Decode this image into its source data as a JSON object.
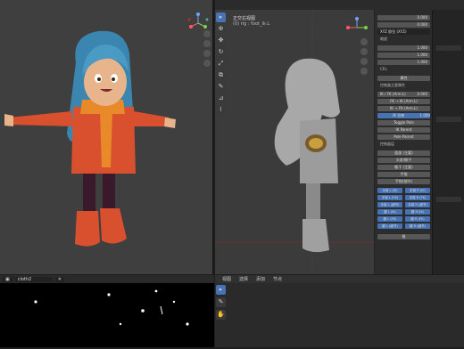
{
  "viewport_right": {
    "header": "正交右视图",
    "subheader": "(0) rig : foot_ik.L"
  },
  "properties_panel": {
    "rows": [
      {
        "type": "num",
        "label": "",
        "value": "0.000"
      },
      {
        "type": "num",
        "label": "",
        "value": "0.000"
      },
      {
        "type": "dark",
        "label": "XYZ 欧拉 (XYZ)",
        "value": ""
      },
      {
        "type": "lbl",
        "label": "缩放",
        "value": ""
      },
      {
        "type": "num",
        "label": "",
        "value": "1.000"
      },
      {
        "type": "num",
        "label": "",
        "value": "1.000"
      },
      {
        "type": "num",
        "label": "",
        "value": "1.000"
      },
      {
        "type": "lbl",
        "label": "CRL",
        "value": ""
      },
      {
        "type": "gray",
        "label": "属性",
        "value": ""
      },
      {
        "type": "lbl",
        "label": "控制器主要属性",
        "value": ""
      },
      {
        "type": "num",
        "label": "IK / FK (Arm.L)",
        "value": "0.000"
      },
      {
        "type": "gray",
        "label": "FK → IK (Arm.L)",
        "value": ""
      },
      {
        "type": "gray",
        "label": "IK → FK (Arm.L)",
        "value": ""
      },
      {
        "type": "blue",
        "label": "IK 拉伸",
        "value": "1.000"
      },
      {
        "type": "gray",
        "label": "Toggle Pole",
        "value": ""
      },
      {
        "type": "gray",
        "label": "IK Parent",
        "value": ""
      },
      {
        "type": "gray",
        "label": "Pole Parent",
        "value": ""
      },
      {
        "type": "lbl",
        "label": "控制器层",
        "value": ""
      },
      {
        "type": "gray",
        "label": "面部 (主要)",
        "value": ""
      },
      {
        "type": "gray",
        "label": "头发/眼子",
        "value": ""
      },
      {
        "type": "gray",
        "label": "躯干 (主要)",
        "value": ""
      },
      {
        "type": "gray",
        "label": "手指",
        "value": ""
      },
      {
        "type": "gray",
        "label": "手指(细节)",
        "value": ""
      }
    ],
    "pairs": [
      [
        "手臂 L (IK)",
        "手臂 R (IK)"
      ],
      [
        "手臂 L (FK)",
        "手臂 R (FK)"
      ],
      [
        "手臂 L (细节)",
        "手臂 R (细节)"
      ],
      [
        "腿 L (IK)",
        "腿 R (IK)"
      ],
      [
        "腿 L (FK)",
        "腿 R (FK)"
      ],
      [
        "腿 L (细节)",
        "腿 R (细节)"
      ]
    ],
    "bottom": "根"
  },
  "timeline": {
    "field": "cloth2"
  },
  "bottom_right_menu": [
    "视图",
    "选择",
    "添加",
    "节点"
  ],
  "colors": {
    "accent": "#4772b3",
    "jacket": "#d9502f",
    "scarf": "#e8892a",
    "hair": "#4a9bc4"
  }
}
